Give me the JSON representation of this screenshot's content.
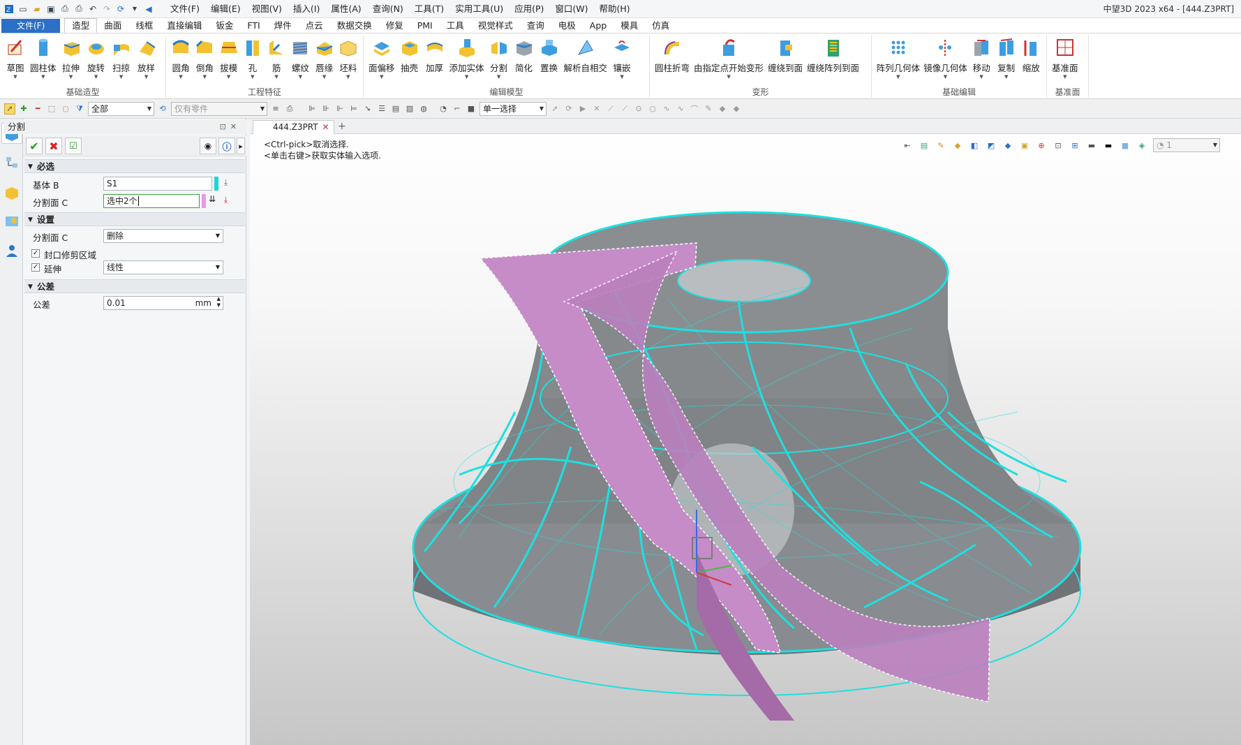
{
  "app_title": "中望3D 2023 x64 - [444.Z3PRT]",
  "menu": [
    "文件(F)",
    "编辑(E)",
    "视图(V)",
    "插入(I)",
    "属性(A)",
    "查询(N)",
    "工具(T)",
    "实用工具(U)",
    "应用(P)",
    "窗口(W)",
    "帮助(H)"
  ],
  "file_tab": "文件(F)",
  "ribbon_tabs": [
    "造型",
    "曲面",
    "线框",
    "直接编辑",
    "钣金",
    "FTI",
    "焊件",
    "点云",
    "数据交换",
    "修复",
    "PMI",
    "工具",
    "视觉样式",
    "查询",
    "电极",
    "App",
    "模具",
    "仿真"
  ],
  "groups": {
    "basic": {
      "name": "基础造型",
      "buttons": [
        "草图",
        "圆柱体",
        "拉伸",
        "旋转",
        "扫掠",
        "放样"
      ]
    },
    "eng": {
      "name": "工程特征",
      "buttons": [
        "圆角",
        "倒角",
        "拔模",
        "孔",
        "筋",
        "螺纹",
        "唇缘",
        "坯料"
      ]
    },
    "edit": {
      "name": "编辑模型",
      "buttons": [
        "面偏移",
        "抽壳",
        "加厚",
        "添加实体",
        "分割",
        "简化",
        "置换",
        "解析自相交",
        "镶嵌"
      ]
    },
    "deform": {
      "name": "变形",
      "buttons": [
        "圆柱折弯",
        "由指定点开始变形",
        "缠绕到面",
        "缠绕阵列到面"
      ]
    },
    "basicedit": {
      "name": "基础编辑",
      "buttons": [
        "阵列几何体",
        "镜像几何体",
        "移动",
        "复制",
        "缩放"
      ]
    },
    "datum": {
      "name": "基准面",
      "buttons": [
        "基准面"
      ]
    }
  },
  "toolbar": {
    "filter": "全部",
    "parts_only": "仅有零件",
    "pick_mode": "单一选择",
    "light": "1"
  },
  "panel": {
    "title": "分割",
    "sections": {
      "required": "必选",
      "settings": "设置",
      "tolerance": "公差"
    },
    "base_label": "基体 B",
    "base_value": "S1",
    "split_label": "分割面 C",
    "split_value": "选中2个",
    "setting_split_label": "分割面 C",
    "setting_split_value": "删除",
    "seal_label": "封口修剪区域",
    "extend_label": "延伸",
    "extend_value": "线性",
    "tol_label": "公差",
    "tol_value": "0.01",
    "tol_unit": "mm"
  },
  "viewport": {
    "doc_tab": "444.Z3PRT",
    "msg1": "<Ctrl-pick>取消选择.",
    "msg2": "<单击右键>获取实体输入选项."
  }
}
